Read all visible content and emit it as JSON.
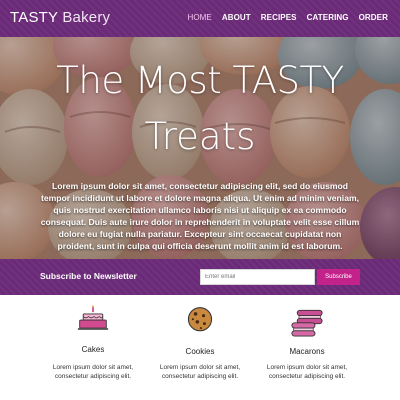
{
  "nav": {
    "brand_main": "TASTY",
    "brand_sub": "Bakery",
    "items": [
      {
        "label": "HOME",
        "active": true
      },
      {
        "label": "ABOUT",
        "active": false
      },
      {
        "label": "RECIPES",
        "active": false
      },
      {
        "label": "CATERING",
        "active": false
      },
      {
        "label": "ORDER",
        "active": false
      }
    ]
  },
  "hero": {
    "title_line1": "The Most TASTY",
    "title_line2": "Treats",
    "text": "Lorem ipsum dolor sit amet, consectetur adipiscing elit, sed do eiusmod tempor incididunt ut labore et dolore magna aliqua. Ut enim ad minim veniam, quis nostrud exercitation ullamco laboris nisi ut aliquip ex ea commodo consequat. Duis aute irure dolor in reprehenderit in voluptate velit esse cillum dolore eu fugiat nulla pariatur. Excepteur sint occaecat cupidatat non proident, sunt in culpa qui officia deserunt mollit anim id est laborum.",
    "background_icon": "macarons-photo"
  },
  "newsletter": {
    "label": "Subscribe to Newsletter",
    "email_placeholder": "Enter email",
    "email_value": "",
    "button_label": "Subscribe"
  },
  "features": [
    {
      "icon": "cake-icon",
      "name": "Cakes",
      "description": "Lorem ipsum dolor sit amet, consectetur adipiscing elit."
    },
    {
      "icon": "cookie-icon",
      "name": "Cookies",
      "description": "Lorem ipsum dolor sit amet, consectetur adipiscing elit."
    },
    {
      "icon": "macarons-icon",
      "name": "Macarons",
      "description": "Lorem ipsum dolor sit amet, consectetur adipiscing elit."
    }
  ],
  "colors": {
    "nav_bg": "#6b2a78",
    "active_link": "#f7c6ef",
    "subscribe_button": "#c2228a"
  }
}
